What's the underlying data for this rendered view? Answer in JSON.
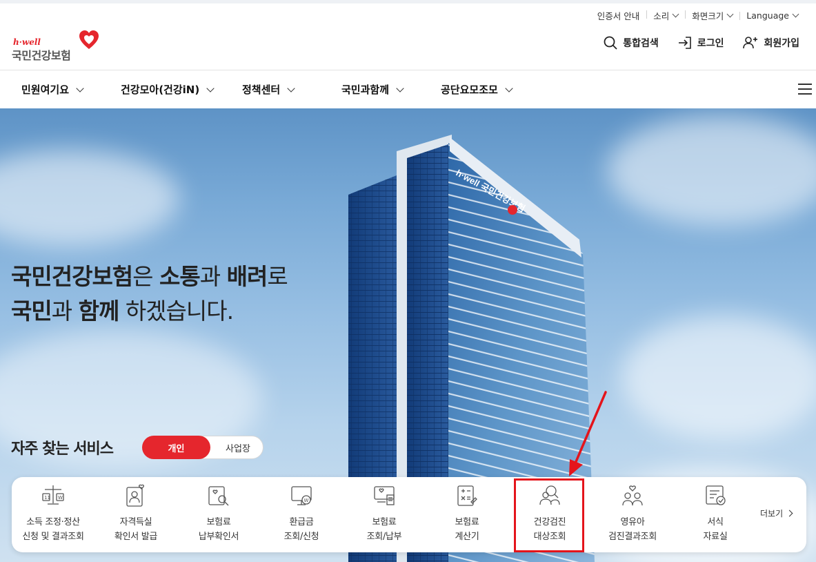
{
  "utility": {
    "items": [
      {
        "label": "인증서 안내",
        "dropdown": false
      },
      {
        "label": "소리",
        "dropdown": true
      },
      {
        "label": "화면크기",
        "dropdown": true
      },
      {
        "label": "Language",
        "dropdown": true
      }
    ]
  },
  "logo": {
    "sub": "h·well",
    "main": "국민건강보험"
  },
  "header": {
    "search": "통합검색",
    "login": "로그인",
    "signup": "회원가입"
  },
  "gnb": {
    "items": [
      "민원여기요",
      "건강모아(건강iN)",
      "정책센터",
      "국민과함께",
      "공단요모조모"
    ]
  },
  "hero": {
    "line1": [
      {
        "t": "국민건강보험",
        "b": true
      },
      {
        "t": "은 ",
        "b": false
      },
      {
        "t": "소통",
        "b": true
      },
      {
        "t": "과 ",
        "b": false
      },
      {
        "t": "배려",
        "b": true
      },
      {
        "t": "로",
        "b": false
      }
    ],
    "line2": [
      {
        "t": "국민",
        "b": true
      },
      {
        "t": "과 ",
        "b": false
      },
      {
        "t": "함께",
        "b": true
      },
      {
        "t": " 하겠습니다.",
        "b": false
      }
    ]
  },
  "services": {
    "title": "자주 찾는 서비스",
    "tabs": {
      "active": "개인",
      "inactive": "사업장"
    },
    "items": [
      {
        "line1": "소득 조정·정산",
        "line2": "신청 및 결과조회",
        "icon": "scale-icon"
      },
      {
        "line1": "자격득실",
        "line2": "확인서 발급",
        "icon": "person-heart-icon"
      },
      {
        "line1": "보험료",
        "line2": "납부확인서",
        "icon": "document-search-icon"
      },
      {
        "line1": "환급금",
        "line2": "조회/신청",
        "icon": "monitor-won-icon"
      },
      {
        "line1": "보험료",
        "line2": "조회/납부",
        "icon": "receipt-won-icon"
      },
      {
        "line1": "보험료",
        "line2": "계산기",
        "icon": "calculator-icon"
      },
      {
        "line1": "건강검진",
        "line2": "대상조회",
        "icon": "people-search-icon"
      },
      {
        "line1": "영유아",
        "line2": "검진결과조회",
        "icon": "family-heart-icon"
      },
      {
        "line1": "서식",
        "line2": "자료실",
        "icon": "form-check-icon"
      }
    ],
    "more": "더보기"
  },
  "colors": {
    "brand": "#e5262d",
    "highlight": "#e4141b",
    "building": "#1f4e8f"
  }
}
